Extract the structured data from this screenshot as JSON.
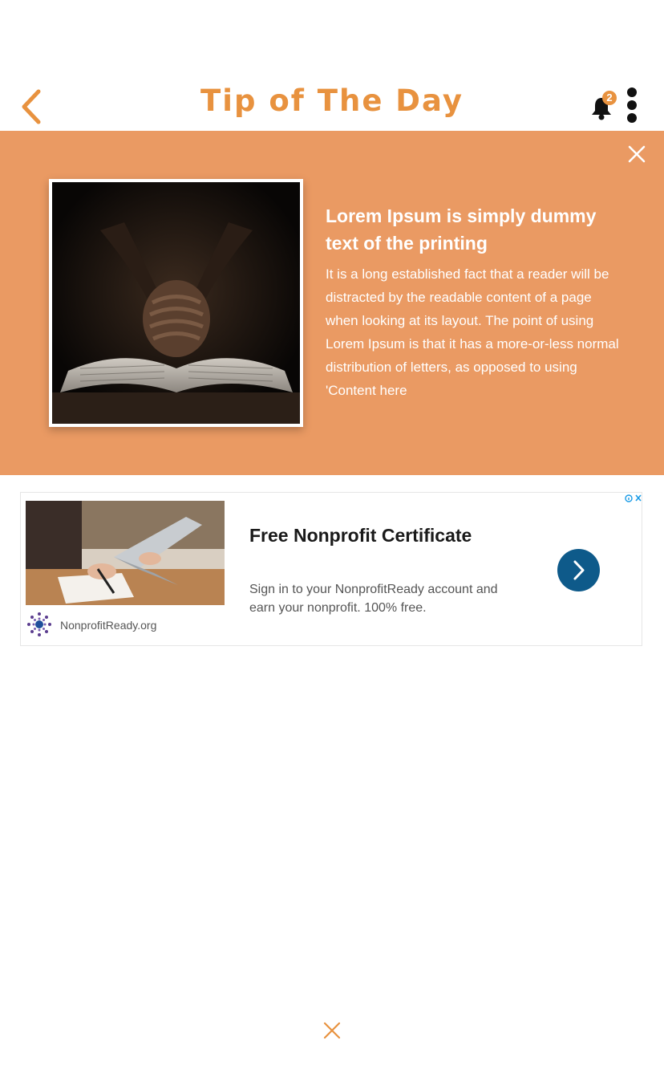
{
  "header": {
    "title": "Tip of The Day",
    "back_icon": "chevron-left-icon",
    "notification_icon": "bell-icon",
    "notification_count": "2",
    "more_icon": "more-vertical-icon"
  },
  "tip": {
    "heading": "Lorem Ipsum is simply dummy text of the printing",
    "body": "It is a long established fact that a reader will be distracted by the readable content of a page when looking at its layout. The point of using Lorem Ipsum is that it has a more-or-less normal distribution of letters, as opposed to using 'Content here",
    "image": "praying-hands-on-bible-photo",
    "close_icon": "close-icon"
  },
  "ad": {
    "title": "Free Nonprofit Certificate",
    "description": "Sign in to your NonprofitReady account and earn your nonprofit. 100% free.",
    "domain": "NonprofitReady.org",
    "image": "person-writing-at-laptop-photo",
    "cta_icon": "chevron-right-icon",
    "adchoices_icon": "adchoices-icon"
  },
  "footer": {
    "close_icon": "close-icon"
  },
  "colors": {
    "accent": "#E8923F",
    "panel": "#EA9A63",
    "cta": "#0E5A8A"
  }
}
